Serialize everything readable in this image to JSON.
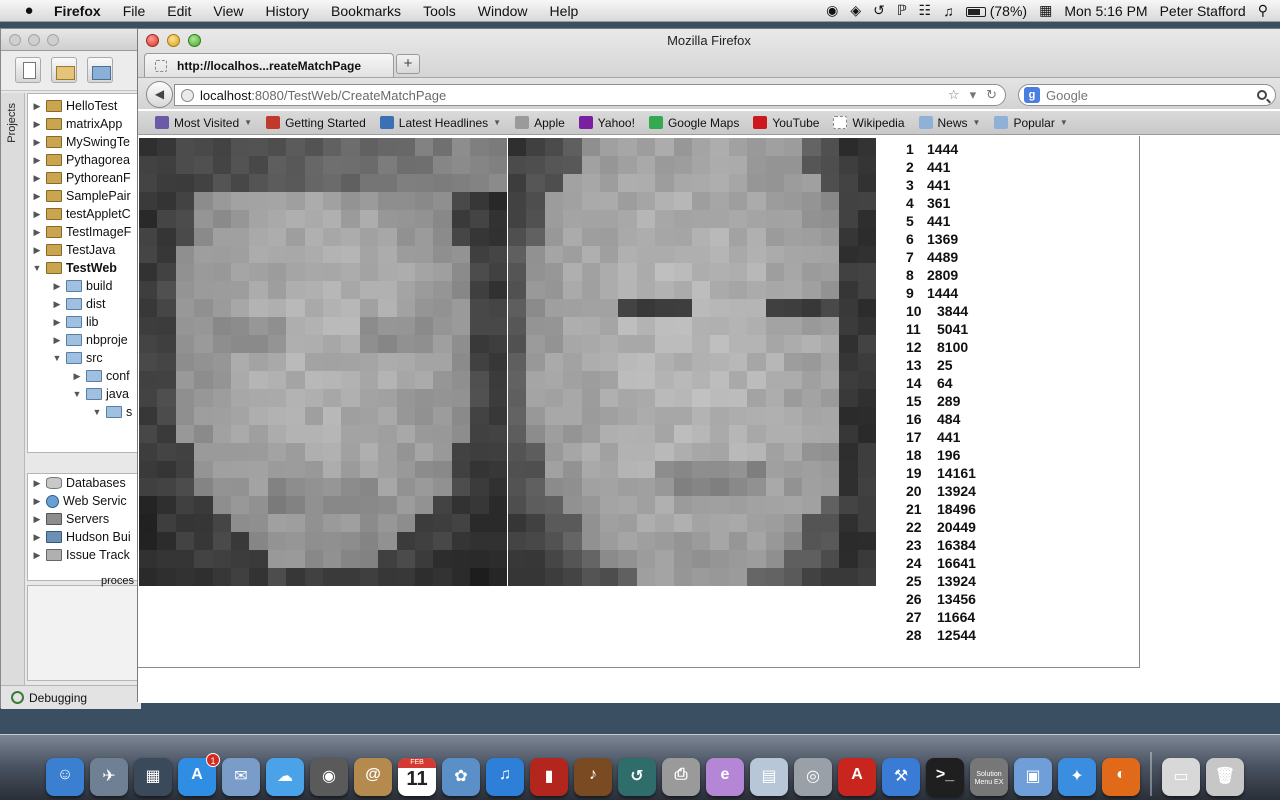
{
  "menubar": {
    "apple": "",
    "app_name": "Firefox",
    "menus": [
      "File",
      "Edit",
      "View",
      "History",
      "Bookmarks",
      "Tools",
      "Window",
      "Help"
    ],
    "battery": "(78%)",
    "clock": "Mon 5:16 PM",
    "user": "Peter Stafford"
  },
  "ide": {
    "side_tab": "Projects",
    "projects": [
      {
        "label": "HelloTest",
        "icon": "project-icon",
        "indent": 0,
        "arrow": "▶",
        "bold": false
      },
      {
        "label": "matrixApp",
        "icon": "project-icon",
        "indent": 0,
        "arrow": "▶",
        "bold": false
      },
      {
        "label": "MySwingTe",
        "icon": "project-icon",
        "indent": 0,
        "arrow": "▶",
        "bold": false
      },
      {
        "label": "Pythagorea",
        "icon": "project-icon",
        "indent": 0,
        "arrow": "▶",
        "bold": false
      },
      {
        "label": "PythoreanF",
        "icon": "project-icon",
        "indent": 0,
        "arrow": "▶",
        "bold": false
      },
      {
        "label": "SamplePair",
        "icon": "project-icon",
        "indent": 0,
        "arrow": "▶",
        "bold": false
      },
      {
        "label": "testAppletC",
        "icon": "project-icon",
        "indent": 0,
        "arrow": "▶",
        "bold": false
      },
      {
        "label": "TestImageF",
        "icon": "project-icon",
        "indent": 0,
        "arrow": "▶",
        "bold": false
      },
      {
        "label": "TestJava",
        "icon": "project-icon",
        "indent": 0,
        "arrow": "▶",
        "bold": false
      },
      {
        "label": "TestWeb",
        "icon": "project-icon",
        "indent": 0,
        "arrow": "▼",
        "bold": true
      },
      {
        "label": "build",
        "icon": "folder-icon",
        "indent": 1,
        "arrow": "▶",
        "bold": false
      },
      {
        "label": "dist",
        "icon": "folder-icon",
        "indent": 1,
        "arrow": "▶",
        "bold": false
      },
      {
        "label": "lib",
        "icon": "folder-icon",
        "indent": 1,
        "arrow": "▶",
        "bold": false
      },
      {
        "label": "nbproje",
        "icon": "folder-icon",
        "indent": 1,
        "arrow": "▶",
        "bold": false
      },
      {
        "label": "src",
        "icon": "folder-icon",
        "indent": 1,
        "arrow": "▼",
        "bold": false
      },
      {
        "label": "conf",
        "icon": "folder-icon",
        "indent": 2,
        "arrow": "▶",
        "bold": false
      },
      {
        "label": "java",
        "icon": "folder-icon",
        "indent": 2,
        "arrow": "▼",
        "bold": false
      },
      {
        "label": "s",
        "icon": "folder-icon",
        "indent": 3,
        "arrow": "▼",
        "bold": false
      }
    ],
    "services": [
      {
        "label": "Databases",
        "icon": "database-icon"
      },
      {
        "label": "Web Servic",
        "icon": "web-services-icon"
      },
      {
        "label": "Servers",
        "icon": "server-icon"
      },
      {
        "label": "Hudson Bui",
        "icon": "hudson-icon"
      },
      {
        "label": "Issue Track",
        "icon": "issue-tracker-icon"
      }
    ],
    "process_label": "proces",
    "debug_label": "Debugging"
  },
  "firefox": {
    "window_title": "Mozilla Firefox",
    "tab_title": "http://localhos...reateMatchPage",
    "new_tab": "+",
    "url_host": "localhost",
    "url_path": ":8080/TestWeb/CreateMatchPage",
    "search_placeholder": "Google",
    "bookmarks": [
      {
        "label": "Most Visited",
        "icon": "most-visited-icon",
        "color": "#6b5aa8",
        "dropdown": true
      },
      {
        "label": "Getting Started",
        "icon": "firefox-icon",
        "color": "#c0392b",
        "dropdown": false
      },
      {
        "label": "Latest Headlines",
        "icon": "rss-icon",
        "color": "#3b6fb6",
        "dropdown": true
      },
      {
        "label": "Apple",
        "icon": "apple-icon",
        "color": "#9a9a9a",
        "dropdown": false
      },
      {
        "label": "Yahoo!",
        "icon": "yahoo-icon",
        "color": "#7b1fa2",
        "dropdown": false
      },
      {
        "label": "Google Maps",
        "icon": "google-maps-icon",
        "color": "#34a853",
        "dropdown": false
      },
      {
        "label": "YouTube",
        "icon": "youtube-icon",
        "color": "#cc181e",
        "dropdown": false
      },
      {
        "label": "Wikipedia",
        "icon": "wikipedia-icon",
        "color": "#ffffff",
        "dropdown": false
      },
      {
        "label": "News",
        "icon": "folder-icon",
        "color": "#8fb1d8",
        "dropdown": true
      },
      {
        "label": "Popular",
        "icon": "folder-icon",
        "color": "#8fb1d8",
        "dropdown": true
      }
    ]
  },
  "page": {
    "scores": [
      {
        "index": "1",
        "value": "1444"
      },
      {
        "index": "2",
        "value": "441"
      },
      {
        "index": "3",
        "value": "441"
      },
      {
        "index": "4",
        "value": "361"
      },
      {
        "index": "5",
        "value": "441"
      },
      {
        "index": "6",
        "value": "1369"
      },
      {
        "index": "7",
        "value": "4489"
      },
      {
        "index": "8",
        "value": "2809"
      },
      {
        "index": "9",
        "value": "1444"
      },
      {
        "index": "10",
        "value": "3844"
      },
      {
        "index": "11",
        "value": "5041"
      },
      {
        "index": "12",
        "value": "8100"
      },
      {
        "index": "13",
        "value": "25"
      },
      {
        "index": "14",
        "value": "64"
      },
      {
        "index": "15",
        "value": "289"
      },
      {
        "index": "16",
        "value": "484"
      },
      {
        "index": "17",
        "value": "441"
      },
      {
        "index": "18",
        "value": "196"
      },
      {
        "index": "19",
        "value": "14161"
      },
      {
        "index": "20",
        "value": "13924"
      },
      {
        "index": "21",
        "value": "18496"
      },
      {
        "index": "22",
        "value": "20449"
      },
      {
        "index": "23",
        "value": "16384"
      },
      {
        "index": "24",
        "value": "16641"
      },
      {
        "index": "25",
        "value": "13924"
      },
      {
        "index": "26",
        "value": "13456"
      },
      {
        "index": "27",
        "value": "11664"
      },
      {
        "index": "28",
        "value": "12544"
      }
    ]
  },
  "dock": {
    "items": [
      {
        "name": "finder-icon",
        "color": "#3b7fd1",
        "glyph": "☺"
      },
      {
        "name": "launchpad-icon",
        "color": "#6f7f94",
        "glyph": "✈"
      },
      {
        "name": "dashboard-icon",
        "color": "#3a4a5a",
        "glyph": "▦"
      },
      {
        "name": "app-store-icon",
        "color": "#2f8de4",
        "glyph": "A",
        "badge": "1"
      },
      {
        "name": "mail-icon",
        "color": "#7a9cc9",
        "glyph": "✉"
      },
      {
        "name": "messages-icon",
        "color": "#4aa3e8",
        "glyph": "☁"
      },
      {
        "name": "facetime-icon",
        "color": "#5a5a5a",
        "glyph": "◉"
      },
      {
        "name": "address-book-icon",
        "color": "#b48a4e",
        "glyph": "@"
      },
      {
        "name": "calendar-icon",
        "type": "calendar",
        "month": "FEB",
        "day": "11"
      },
      {
        "name": "iphoto-icon",
        "color": "#5b8fc7",
        "glyph": "✿"
      },
      {
        "name": "itunes-icon",
        "color": "#2e7fd8",
        "glyph": "♫"
      },
      {
        "name": "photo-booth-icon",
        "color": "#b3261e",
        "glyph": "▮"
      },
      {
        "name": "garageband-icon",
        "color": "#7a4b22",
        "glyph": "♪"
      },
      {
        "name": "time-machine-icon",
        "color": "#2f6d6a",
        "glyph": "↺"
      },
      {
        "name": "printer-icon",
        "color": "#9a9a9a",
        "glyph": "⎙"
      },
      {
        "name": "eclipse-icon",
        "color": "#b586d6",
        "glyph": "e"
      },
      {
        "name": "preview-icon",
        "color": "#b7c7d8",
        "glyph": "▤"
      },
      {
        "name": "image-capture-icon",
        "color": "#9aa0a8",
        "glyph": "◎"
      },
      {
        "name": "acrobat-icon",
        "color": "#c8251f",
        "glyph": "A"
      },
      {
        "name": "xcode-icon",
        "color": "#3a7bd5",
        "glyph": "⚒"
      },
      {
        "name": "terminal-icon",
        "color": "#1f1f1f",
        "glyph": ">_"
      },
      {
        "name": "solution-menu-icon",
        "color": "#777777",
        "type": "solution",
        "label": "Solution Menu EX"
      },
      {
        "name": "virtualbox-icon",
        "color": "#6f9ed8",
        "glyph": "▣"
      },
      {
        "name": "safari-icon",
        "color": "#3b8de0",
        "glyph": "✦"
      },
      {
        "name": "firefox-dock-icon",
        "color": "#e16a1a",
        "glyph": "◐"
      },
      {
        "name": "separator"
      },
      {
        "name": "downloads-icon",
        "color": "#d8d8d8",
        "glyph": "▭"
      },
      {
        "name": "trash-icon",
        "color": "#c7c7c7",
        "glyph": "🗑"
      }
    ]
  }
}
